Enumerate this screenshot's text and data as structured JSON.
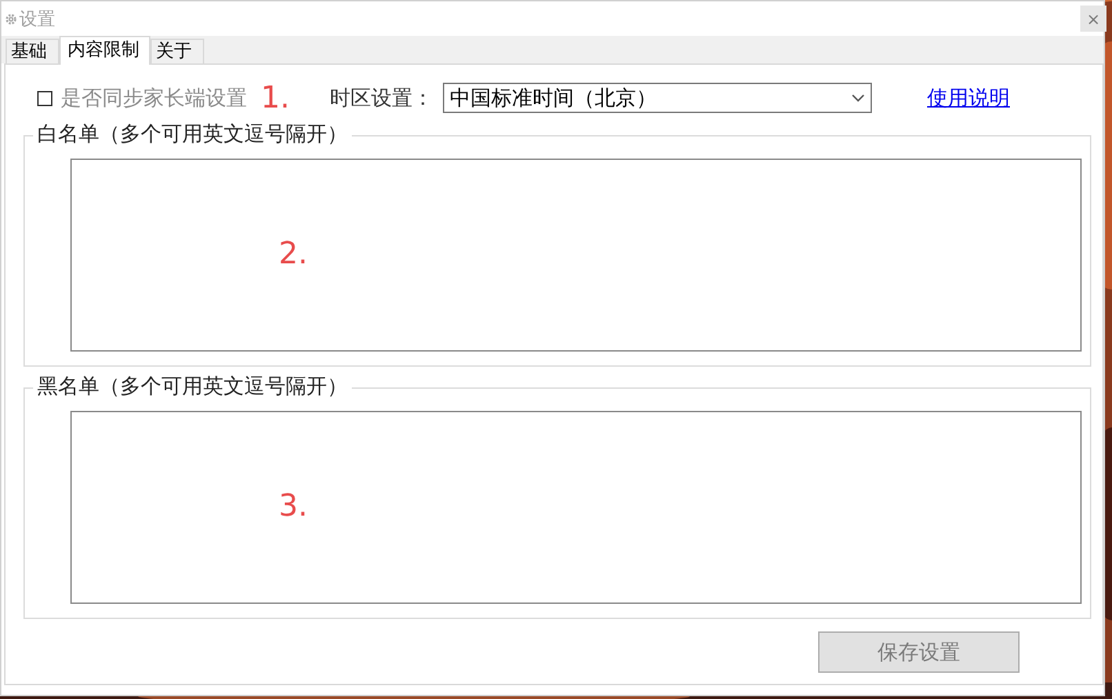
{
  "window": {
    "title": "设置",
    "close": "×"
  },
  "tabs": [
    {
      "label": "基础",
      "selected": false
    },
    {
      "label": "内容限制",
      "selected": true
    },
    {
      "label": "关于",
      "selected": false
    }
  ],
  "sync_checkbox": {
    "label": "是否同步家长端设置",
    "checked": false,
    "disabled": true
  },
  "timezone": {
    "label": "时区设置：",
    "value": "中国标准时间（北京）"
  },
  "help_link": "使用说明",
  "groups": [
    {
      "title": "白名单（多个可用英文逗号隔开）"
    },
    {
      "title": "黑名单（多个可用英文逗号隔开）"
    }
  ],
  "save_button": {
    "label": "保存设置",
    "disabled": true
  },
  "annotations": [
    "1.",
    "2.",
    "3."
  ]
}
